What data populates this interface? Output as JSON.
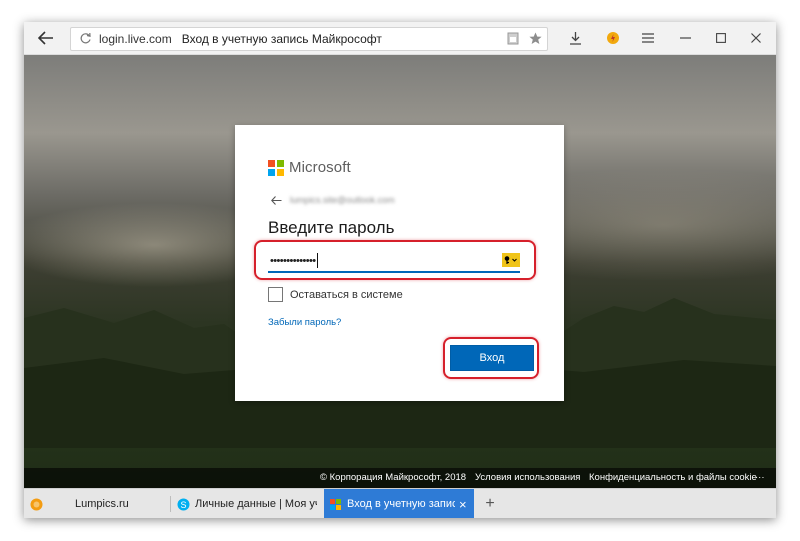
{
  "browser": {
    "back_icon": "arrow-left-icon",
    "reload_icon": "reload-icon",
    "url_host": "login.live.com",
    "page_title": "Вход в учетную запись Майкрософт",
    "toolbar_icons": [
      "reader-icon",
      "star-icon",
      "download-icon",
      "extension-icon",
      "menu-icon",
      "minimize-icon",
      "maximize-icon",
      "close-icon"
    ]
  },
  "login": {
    "brand": "Microsoft",
    "email": "lumpics.site@outlook.com",
    "heading": "Введите пароль",
    "password": "••••••••••••••",
    "stay_signed_in": "Оставаться в системе",
    "forgot_password": "Забыли пароль?",
    "sign_in": "Вход"
  },
  "footer": {
    "copyright": "© Корпорация Майкрософт, 2018",
    "terms": "Условия использования",
    "privacy": "Конфиденциальность и файлы cookie",
    "more": "···"
  },
  "tabs": [
    {
      "label": "Lumpics.ru",
      "active": false
    },
    {
      "label": "Личные данные | Моя учет",
      "active": false
    },
    {
      "label": "Вход в учетную запись М",
      "active": true
    }
  ],
  "new_tab": "+",
  "close_tab": "×",
  "colors": {
    "accent": "#0067b8",
    "highlight": "#d6202b",
    "key_icon": "#f0c419"
  }
}
